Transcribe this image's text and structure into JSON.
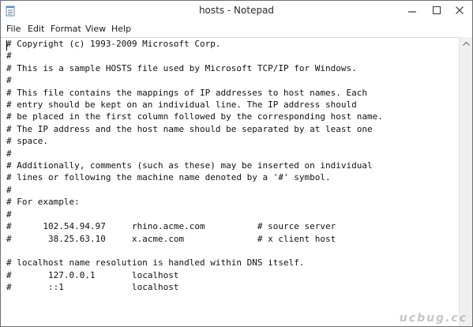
{
  "window": {
    "title": "hosts - Notepad"
  },
  "menu": {
    "items": [
      "File",
      "Edit",
      "Format",
      "View",
      "Help"
    ]
  },
  "document": {
    "text": "# Copyright (c) 1993-2009 Microsoft Corp.\n#\n# This is a sample HOSTS file used by Microsoft TCP/IP for Windows.\n#\n# This file contains the mappings of IP addresses to host names. Each\n# entry should be kept on an individual line. The IP address should\n# be placed in the first column followed by the corresponding host name.\n# The IP address and the host name should be separated by at least one\n# space.\n#\n# Additionally, comments (such as these) may be inserted on individual\n# lines or following the machine name denoted by a '#' symbol.\n#\n# For example:\n#\n#      102.54.94.97     rhino.acme.com          # source server\n#       38.25.63.10     x.acme.com              # x client host\n\n# localhost name resolution is handled within DNS itself.\n#\t127.0.0.1       localhost\n#\t::1             localhost"
  },
  "watermark": {
    "text": "ucbug.cc"
  },
  "icons": {
    "app": "notepad-icon",
    "minimize": "minimize-icon",
    "maximize": "maximize-icon",
    "close": "close-icon",
    "scroll_up": "chevron-up-icon"
  }
}
